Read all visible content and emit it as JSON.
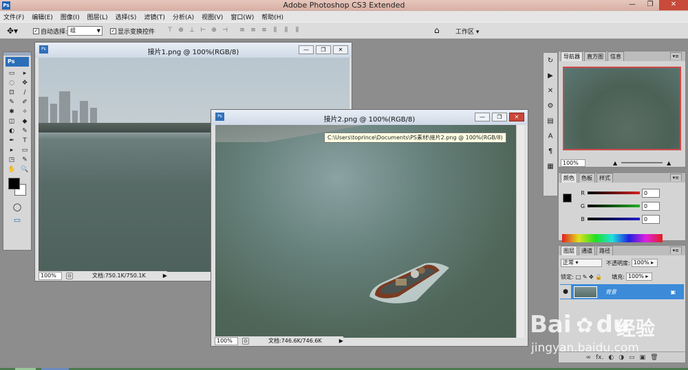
{
  "app": {
    "title": "Adobe Photoshop CS3 Extended",
    "logo": "Ps",
    "window_buttons": [
      "—",
      "❐",
      "✕"
    ]
  },
  "menu": [
    "文件(F)",
    "编辑(E)",
    "图像(I)",
    "图层(L)",
    "选择(S)",
    "滤镜(T)",
    "分析(A)",
    "视图(V)",
    "窗口(W)",
    "帮助(H)"
  ],
  "options_bar": {
    "auto_select_label": "自动选择:",
    "auto_select_value": "组",
    "show_transform_label": "显示变换控件",
    "workspace_label": "工作区",
    "align_icons": [
      "⊤",
      "⊕",
      "⊥",
      "⊢",
      "⊕",
      "⊣"
    ],
    "distribute_icons": [
      "≡",
      "≡",
      "≡",
      "⫼",
      "⫼",
      "⫼"
    ]
  },
  "toolbox": {
    "logo": "Ps",
    "tools": [
      "▭",
      "▸",
      "◌",
      "✥",
      "⊡",
      "∕",
      "✎",
      "✐",
      "✱",
      "✧",
      "◫",
      "◆",
      "◐",
      "✎",
      "✒",
      "T",
      "▸",
      "▭",
      "◳",
      "✎",
      "✋",
      "🔍"
    ],
    "quickmask": "◯",
    "screenmode": "▭"
  },
  "doc1": {
    "title": "接片1.png @ 100%(RGB/8)",
    "zoom": "100%",
    "info": "文档:750.1K/750.1K"
  },
  "doc2": {
    "title": "接片2.png @ 100%(RGB/8)",
    "zoom": "100%",
    "info": "文档:746.6K/746.6K",
    "tooltip": "C:\\Users\\toprince\\Documents\\PS素材\\接片2.png @ 100%(RGB/8)"
  },
  "icon_column": [
    "↻",
    "▶",
    "✕",
    "⚙",
    "▤",
    "A",
    "¶",
    "▦"
  ],
  "navigator_panel": {
    "tabs": [
      "导航器",
      "直方图",
      "信息"
    ],
    "zoom": "100%"
  },
  "color_panel": {
    "tabs": [
      "颜色",
      "色板",
      "样式"
    ],
    "channels": [
      {
        "label": "R",
        "value": "0",
        "color": "#d42020"
      },
      {
        "label": "G",
        "value": "0",
        "color": "#20b020"
      },
      {
        "label": "B",
        "value": "0",
        "color": "#2020c8"
      }
    ]
  },
  "layers_panel": {
    "tabs": [
      "图层",
      "通道",
      "路径"
    ],
    "blend_mode": "正常",
    "opacity_label": "不透明度:",
    "opacity": "100%",
    "lock_label": "锁定:",
    "lock_icons": "□ ✎ ✥ 🔒",
    "fill_label": "填充:",
    "fill": "100%",
    "layer_name": "背景",
    "bottom_icons": [
      "∞",
      "fx.",
      "◐",
      "◑",
      "▭",
      "▣",
      "🗑"
    ]
  },
  "watermark": {
    "brand": "Bai",
    "brand_suffix": "du",
    "cn": "经验",
    "url": "jingyan.baidu.com"
  }
}
